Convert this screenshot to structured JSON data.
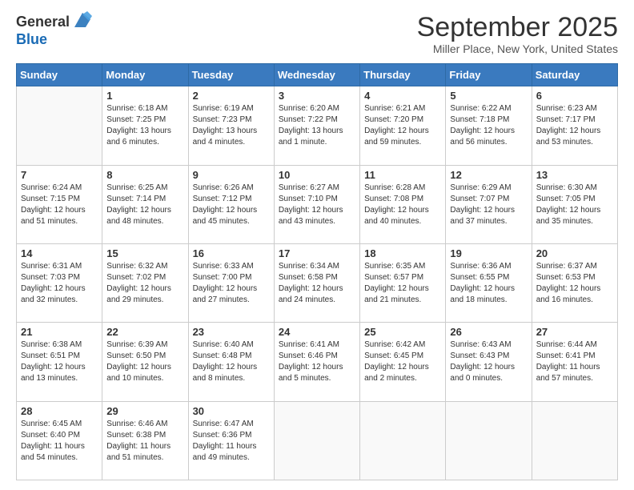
{
  "header": {
    "logo_line1": "General",
    "logo_line2": "Blue",
    "month_title": "September 2025",
    "subtitle": "Miller Place, New York, United States"
  },
  "days_of_week": [
    "Sunday",
    "Monday",
    "Tuesday",
    "Wednesday",
    "Thursday",
    "Friday",
    "Saturday"
  ],
  "weeks": [
    [
      {
        "day": "",
        "content": ""
      },
      {
        "day": "1",
        "content": "Sunrise: 6:18 AM\nSunset: 7:25 PM\nDaylight: 13 hours\nand 6 minutes."
      },
      {
        "day": "2",
        "content": "Sunrise: 6:19 AM\nSunset: 7:23 PM\nDaylight: 13 hours\nand 4 minutes."
      },
      {
        "day": "3",
        "content": "Sunrise: 6:20 AM\nSunset: 7:22 PM\nDaylight: 13 hours\nand 1 minute."
      },
      {
        "day": "4",
        "content": "Sunrise: 6:21 AM\nSunset: 7:20 PM\nDaylight: 12 hours\nand 59 minutes."
      },
      {
        "day": "5",
        "content": "Sunrise: 6:22 AM\nSunset: 7:18 PM\nDaylight: 12 hours\nand 56 minutes."
      },
      {
        "day": "6",
        "content": "Sunrise: 6:23 AM\nSunset: 7:17 PM\nDaylight: 12 hours\nand 53 minutes."
      }
    ],
    [
      {
        "day": "7",
        "content": "Sunrise: 6:24 AM\nSunset: 7:15 PM\nDaylight: 12 hours\nand 51 minutes."
      },
      {
        "day": "8",
        "content": "Sunrise: 6:25 AM\nSunset: 7:14 PM\nDaylight: 12 hours\nand 48 minutes."
      },
      {
        "day": "9",
        "content": "Sunrise: 6:26 AM\nSunset: 7:12 PM\nDaylight: 12 hours\nand 45 minutes."
      },
      {
        "day": "10",
        "content": "Sunrise: 6:27 AM\nSunset: 7:10 PM\nDaylight: 12 hours\nand 43 minutes."
      },
      {
        "day": "11",
        "content": "Sunrise: 6:28 AM\nSunset: 7:08 PM\nDaylight: 12 hours\nand 40 minutes."
      },
      {
        "day": "12",
        "content": "Sunrise: 6:29 AM\nSunset: 7:07 PM\nDaylight: 12 hours\nand 37 minutes."
      },
      {
        "day": "13",
        "content": "Sunrise: 6:30 AM\nSunset: 7:05 PM\nDaylight: 12 hours\nand 35 minutes."
      }
    ],
    [
      {
        "day": "14",
        "content": "Sunrise: 6:31 AM\nSunset: 7:03 PM\nDaylight: 12 hours\nand 32 minutes."
      },
      {
        "day": "15",
        "content": "Sunrise: 6:32 AM\nSunset: 7:02 PM\nDaylight: 12 hours\nand 29 minutes."
      },
      {
        "day": "16",
        "content": "Sunrise: 6:33 AM\nSunset: 7:00 PM\nDaylight: 12 hours\nand 27 minutes."
      },
      {
        "day": "17",
        "content": "Sunrise: 6:34 AM\nSunset: 6:58 PM\nDaylight: 12 hours\nand 24 minutes."
      },
      {
        "day": "18",
        "content": "Sunrise: 6:35 AM\nSunset: 6:57 PM\nDaylight: 12 hours\nand 21 minutes."
      },
      {
        "day": "19",
        "content": "Sunrise: 6:36 AM\nSunset: 6:55 PM\nDaylight: 12 hours\nand 18 minutes."
      },
      {
        "day": "20",
        "content": "Sunrise: 6:37 AM\nSunset: 6:53 PM\nDaylight: 12 hours\nand 16 minutes."
      }
    ],
    [
      {
        "day": "21",
        "content": "Sunrise: 6:38 AM\nSunset: 6:51 PM\nDaylight: 12 hours\nand 13 minutes."
      },
      {
        "day": "22",
        "content": "Sunrise: 6:39 AM\nSunset: 6:50 PM\nDaylight: 12 hours\nand 10 minutes."
      },
      {
        "day": "23",
        "content": "Sunrise: 6:40 AM\nSunset: 6:48 PM\nDaylight: 12 hours\nand 8 minutes."
      },
      {
        "day": "24",
        "content": "Sunrise: 6:41 AM\nSunset: 6:46 PM\nDaylight: 12 hours\nand 5 minutes."
      },
      {
        "day": "25",
        "content": "Sunrise: 6:42 AM\nSunset: 6:45 PM\nDaylight: 12 hours\nand 2 minutes."
      },
      {
        "day": "26",
        "content": "Sunrise: 6:43 AM\nSunset: 6:43 PM\nDaylight: 12 hours\nand 0 minutes."
      },
      {
        "day": "27",
        "content": "Sunrise: 6:44 AM\nSunset: 6:41 PM\nDaylight: 11 hours\nand 57 minutes."
      }
    ],
    [
      {
        "day": "28",
        "content": "Sunrise: 6:45 AM\nSunset: 6:40 PM\nDaylight: 11 hours\nand 54 minutes."
      },
      {
        "day": "29",
        "content": "Sunrise: 6:46 AM\nSunset: 6:38 PM\nDaylight: 11 hours\nand 51 minutes."
      },
      {
        "day": "30",
        "content": "Sunrise: 6:47 AM\nSunset: 6:36 PM\nDaylight: 11 hours\nand 49 minutes."
      },
      {
        "day": "",
        "content": ""
      },
      {
        "day": "",
        "content": ""
      },
      {
        "day": "",
        "content": ""
      },
      {
        "day": "",
        "content": ""
      }
    ]
  ]
}
